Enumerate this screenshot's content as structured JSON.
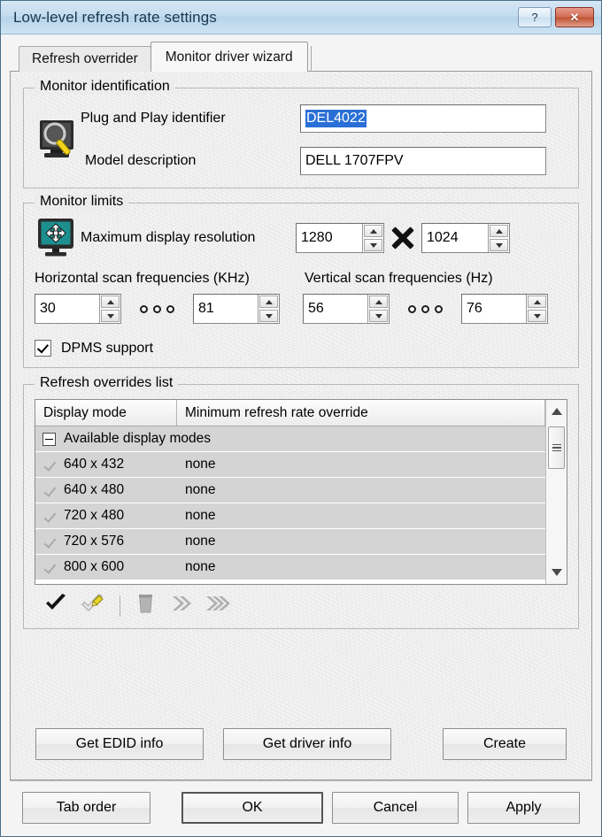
{
  "window": {
    "title": "Low-level refresh rate settings",
    "help_button": "?",
    "close_button": "✕"
  },
  "tabs": [
    {
      "label": "Refresh overrider",
      "active": false
    },
    {
      "label": "Monitor driver wizard",
      "active": true
    }
  ],
  "monitor_identification": {
    "group_title": "Monitor identification",
    "icon": "monitor-magnifier-icon",
    "pnp_label": "Plug and Play identifier",
    "pnp_value": "DEL4022",
    "pnp_selected": true,
    "model_label": "Model description",
    "model_value": "DELL 1707FPV"
  },
  "monitor_limits": {
    "group_title": "Monitor limits",
    "icon": "monitor-resolution-icon",
    "resolution_label": "Maximum display resolution",
    "res_width": "1280",
    "res_height": "1024",
    "multiply_glyph": "×",
    "h_scan_label": "Horizontal scan frequencies (KHz)",
    "v_scan_label": "Vertical scan frequencies (Hz)",
    "h_min": "30",
    "h_max": "81",
    "v_min": "56",
    "v_max": "76",
    "range_separator": "ooo",
    "dpms_label": "DPMS support",
    "dpms_checked": true
  },
  "refresh_overrides": {
    "group_title": "Refresh overrides list",
    "columns": [
      "Display mode",
      "Minimum refresh rate override"
    ],
    "group_row": "Available display modes",
    "rows": [
      {
        "mode": "640 x 432",
        "override": "none"
      },
      {
        "mode": "640 x 480",
        "override": "none"
      },
      {
        "mode": "720 x 480",
        "override": "none"
      },
      {
        "mode": "720 x 576",
        "override": "none"
      },
      {
        "mode": "800 x 600",
        "override": "none"
      }
    ],
    "toolbar": [
      {
        "name": "apply-check-icon",
        "title": "Enable"
      },
      {
        "name": "edit-check-pencil-icon",
        "title": "Edit"
      },
      {
        "name": "delete-trash-icon",
        "title": "Delete"
      },
      {
        "name": "forward-double-chevron-icon",
        "title": "Move"
      },
      {
        "name": "forward-triple-chevron-icon",
        "title": "Move all"
      }
    ],
    "scroll_up": "▲",
    "scroll_down": "▼"
  },
  "action_buttons": {
    "edid": "Get EDID info",
    "driver": "Get driver info",
    "create": "Create"
  },
  "footer_buttons": {
    "tab_order": "Tab order",
    "ok": "OK",
    "cancel": "Cancel",
    "apply": "Apply"
  },
  "colors": {
    "title_bar": "#c3dcef",
    "close_red": "#c0512f",
    "selection_blue": "#2a6fd6",
    "monitor_screen_teal": "#1d8f8f",
    "list_row": "#d4d4d4"
  }
}
